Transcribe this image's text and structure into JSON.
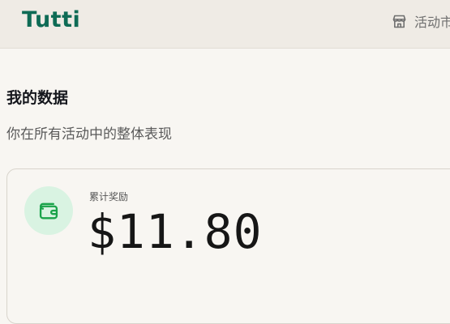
{
  "header": {
    "logo": "Tutti",
    "nav_activity_label": "活动市场",
    "brand_color": "#0e6b55"
  },
  "section": {
    "title": "我的数据",
    "subtitle": "你在所有活动中的整体表现"
  },
  "stats": {
    "rewards": {
      "label": "累计奖励",
      "value": "$11.80",
      "icon": "wallet-icon",
      "icon_color": "#1aa34a",
      "icon_bg": "#d9f3e2"
    }
  }
}
